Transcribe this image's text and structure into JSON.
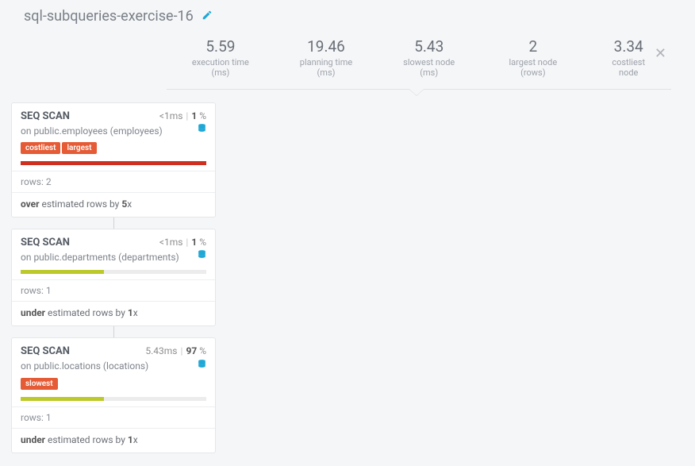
{
  "header": {
    "title": "sql-subqueries-exercise-16"
  },
  "stats": {
    "execution": {
      "value": "5.59",
      "label": "execution time (ms)"
    },
    "planning": {
      "value": "19.46",
      "label": "planning time (ms)"
    },
    "slowest": {
      "value": "5.43",
      "label": "slowest node (ms)"
    },
    "largest": {
      "value": "2",
      "label": "largest node (rows)"
    },
    "costliest": {
      "value": "3.34",
      "label": "costliest node"
    }
  },
  "nodes": [
    {
      "title": "SEQ SCAN",
      "time_prefix": "<1",
      "time_unit": "ms",
      "pct": "1",
      "subtitle": "on public.employees (employees)",
      "tags": [
        "costliest",
        "largest"
      ],
      "bar_color": "bar-red",
      "bar_width": "100%",
      "rows": "rows: 2",
      "est_dir": "over",
      "est_mid": " estimated rows by ",
      "est_val": "5",
      "est_suffix": "x"
    },
    {
      "title": "SEQ SCAN",
      "time_prefix": "<1",
      "time_unit": "ms",
      "pct": "1",
      "subtitle": "on public.departments (departments)",
      "tags": [],
      "bar_color": "bar-olive",
      "bar_width": "45%",
      "rows": "rows: 1",
      "est_dir": "under",
      "est_mid": " estimated rows by ",
      "est_val": "1",
      "est_suffix": "x"
    },
    {
      "title": "SEQ SCAN",
      "time_prefix": "5.43",
      "time_unit": "ms",
      "pct": "97",
      "subtitle": "on public.locations (locations)",
      "tags": [
        "slowest"
      ],
      "bar_color": "bar-olive",
      "bar_width": "45%",
      "rows": "rows: 1",
      "est_dir": "under",
      "est_mid": " estimated rows by ",
      "est_val": "1",
      "est_suffix": "x"
    }
  ]
}
